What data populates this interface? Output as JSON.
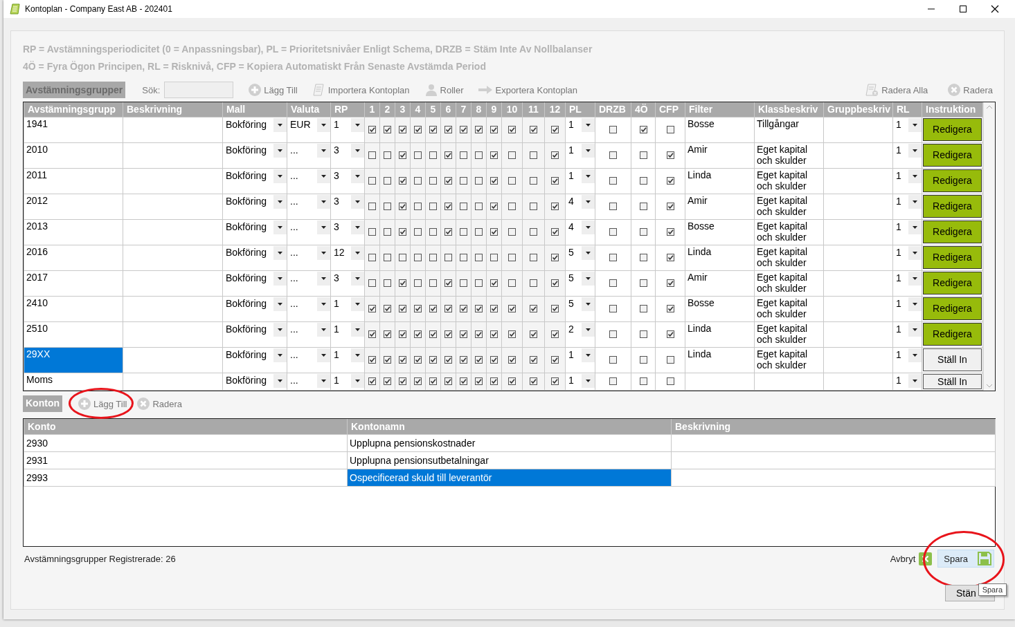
{
  "window": {
    "title": "Kontoplan - Company East AB - 202401"
  },
  "legend": [
    "RP = Avstämningsperiodicitet (0 = Anpassningsbar), PL = Prioritetsnivåer Enligt Schema, DRZB = Stäm Inte Av Nollbalanser",
    "4Ö = Fyra Ögon Principen, RL = Risknivå, CFP = Kopiera Automatiskt Från Senaste Avstämda Period"
  ],
  "toolbar": {
    "section_label": "Avstämningsgrupper",
    "search_label": "Sök:",
    "actions": [
      {
        "kind": "add",
        "label": "Lägg Till"
      },
      {
        "kind": "import",
        "label": "Importera Kontoplan"
      },
      {
        "kind": "roles",
        "label": "Roller"
      },
      {
        "kind": "export",
        "label": "Exportera Kontoplan"
      }
    ],
    "actions_right": [
      {
        "kind": "delete_all",
        "label": "Radera Alla"
      },
      {
        "kind": "delete",
        "label": "Radera"
      }
    ]
  },
  "groups_table": {
    "columns": [
      "Avstämningsgrupp",
      "Beskrivning",
      "Mall",
      "Valuta",
      "RP",
      "1",
      "2",
      "3",
      "4",
      "5",
      "6",
      "7",
      "8",
      "9",
      "10",
      "11",
      "12",
      "PL",
      "DRZB",
      "4Ö",
      "CFP",
      "Filter",
      "Klassbeskriv",
      "Gruppbeskriv",
      "RL",
      "Instruktion"
    ],
    "rows": [
      {
        "group": "1941",
        "selected": false,
        "template": "Bokföring",
        "currency": "EUR",
        "rp": "1",
        "months": [
          true,
          true,
          true,
          true,
          true,
          true,
          true,
          true,
          true,
          true,
          true,
          true
        ],
        "pl": "1",
        "drzb": false,
        "four_eyes": true,
        "cfp": false,
        "filter": "Bosse",
        "class_description": "Tillgångar",
        "rl": "1",
        "instruction": {
          "kind": "edit",
          "label": "Redigera"
        }
      },
      {
        "group": "2010",
        "selected": false,
        "template": "Bokföring",
        "currency": "...",
        "rp": "3",
        "months": [
          false,
          false,
          true,
          false,
          false,
          true,
          false,
          false,
          true,
          false,
          false,
          true
        ],
        "pl": "1",
        "drzb": false,
        "four_eyes": false,
        "cfp": true,
        "filter": "Amir",
        "class_description": "Eget kapital och skulder",
        "rl": "1",
        "instruction": {
          "kind": "edit",
          "label": "Redigera"
        }
      },
      {
        "group": "2011",
        "selected": false,
        "template": "Bokföring",
        "currency": "...",
        "rp": "3",
        "months": [
          false,
          false,
          true,
          false,
          false,
          true,
          false,
          false,
          true,
          false,
          false,
          true
        ],
        "pl": "1",
        "drzb": false,
        "four_eyes": false,
        "cfp": true,
        "filter": "Linda",
        "class_description": "Eget kapital och skulder",
        "rl": "1",
        "instruction": {
          "kind": "edit",
          "label": "Redigera"
        }
      },
      {
        "group": "2012",
        "selected": false,
        "template": "Bokföring",
        "currency": "...",
        "rp": "3",
        "months": [
          false,
          false,
          true,
          false,
          false,
          true,
          false,
          false,
          true,
          false,
          false,
          true
        ],
        "pl": "4",
        "drzb": false,
        "four_eyes": false,
        "cfp": true,
        "filter": "Amir",
        "class_description": "Eget kapital och skulder",
        "rl": "1",
        "instruction": {
          "kind": "edit",
          "label": "Redigera"
        }
      },
      {
        "group": "2013",
        "selected": false,
        "template": "Bokföring",
        "currency": "...",
        "rp": "3",
        "months": [
          false,
          false,
          true,
          false,
          false,
          true,
          false,
          false,
          true,
          false,
          false,
          true
        ],
        "pl": "4",
        "drzb": false,
        "four_eyes": false,
        "cfp": true,
        "filter": "Bosse",
        "class_description": "Eget kapital och skulder",
        "rl": "1",
        "instruction": {
          "kind": "edit",
          "label": "Redigera"
        }
      },
      {
        "group": "2016",
        "selected": false,
        "template": "Bokföring",
        "currency": "...",
        "rp": "12",
        "months": [
          false,
          false,
          false,
          false,
          false,
          false,
          false,
          false,
          false,
          false,
          false,
          true
        ],
        "pl": "5",
        "drzb": false,
        "four_eyes": false,
        "cfp": true,
        "filter": "Linda",
        "class_description": "Eget kapital och skulder",
        "rl": "1",
        "instruction": {
          "kind": "edit",
          "label": "Redigera"
        }
      },
      {
        "group": "2017",
        "selected": false,
        "template": "Bokföring",
        "currency": "...",
        "rp": "3",
        "months": [
          false,
          false,
          true,
          false,
          false,
          true,
          false,
          false,
          true,
          false,
          false,
          true
        ],
        "pl": "5",
        "drzb": false,
        "four_eyes": false,
        "cfp": true,
        "filter": "Amir",
        "class_description": "Eget kapital och skulder",
        "rl": "1",
        "instruction": {
          "kind": "edit",
          "label": "Redigera"
        }
      },
      {
        "group": "2410",
        "selected": false,
        "template": "Bokföring",
        "currency": "...",
        "rp": "1",
        "months": [
          true,
          true,
          true,
          true,
          true,
          true,
          true,
          true,
          true,
          true,
          true,
          true
        ],
        "pl": "5",
        "drzb": false,
        "four_eyes": false,
        "cfp": true,
        "filter": "Bosse",
        "class_description": "Eget kapital och skulder",
        "rl": "1",
        "instruction": {
          "kind": "edit",
          "label": "Redigera"
        }
      },
      {
        "group": "2510",
        "selected": false,
        "template": "Bokföring",
        "currency": "...",
        "rp": "1",
        "months": [
          true,
          true,
          true,
          true,
          true,
          true,
          true,
          true,
          true,
          true,
          true,
          true
        ],
        "pl": "2",
        "drzb": false,
        "four_eyes": false,
        "cfp": true,
        "filter": "Linda",
        "class_description": "Eget kapital och skulder",
        "rl": "1",
        "instruction": {
          "kind": "edit",
          "label": "Redigera"
        }
      },
      {
        "group": "29XX",
        "selected": true,
        "template": "Bokföring",
        "currency": "...",
        "rp": "1",
        "months": [
          true,
          true,
          true,
          true,
          true,
          true,
          true,
          true,
          true,
          true,
          true,
          true
        ],
        "pl": "1",
        "drzb": false,
        "four_eyes": false,
        "cfp": false,
        "filter": "Linda",
        "class_description": "Eget kapital och skulder",
        "rl": "1",
        "instruction": {
          "kind": "set",
          "label": "Ställ In"
        }
      },
      {
        "group": "Moms",
        "selected": false,
        "template": "Bokföring",
        "currency": "...",
        "rp": "1",
        "months": [
          true,
          true,
          true,
          true,
          true,
          true,
          true,
          true,
          true,
          true,
          true,
          true
        ],
        "pl": "1",
        "drzb": false,
        "four_eyes": false,
        "cfp": false,
        "rl": "1",
        "instruction": {
          "kind": "set",
          "label": "Ställ In"
        }
      }
    ]
  },
  "accounts": {
    "label": "Konton",
    "actions": [
      {
        "kind": "add",
        "label": "Lägg Till",
        "annotated": true
      },
      {
        "kind": "delete",
        "label": "Radera",
        "annotated": false
      }
    ],
    "columns": [
      "Konto",
      "Kontonamn",
      "Beskrivning"
    ],
    "rows": [
      {
        "account": "2930",
        "name": "Upplupna pensionskostnader",
        "selected": false
      },
      {
        "account": "2931",
        "name": "Upplupna pensionsutbetalningar",
        "selected": false
      },
      {
        "account": "2993",
        "name": "Ospecificerad skuld till leverantör",
        "selected": true
      }
    ]
  },
  "status": "Avstämningsgrupper Registrerade: 26",
  "footer": {
    "cancel": "Avbryt",
    "save": {
      "label": "Spara",
      "annotated": true
    },
    "close": "Stän",
    "tooltip": "Spara"
  }
}
